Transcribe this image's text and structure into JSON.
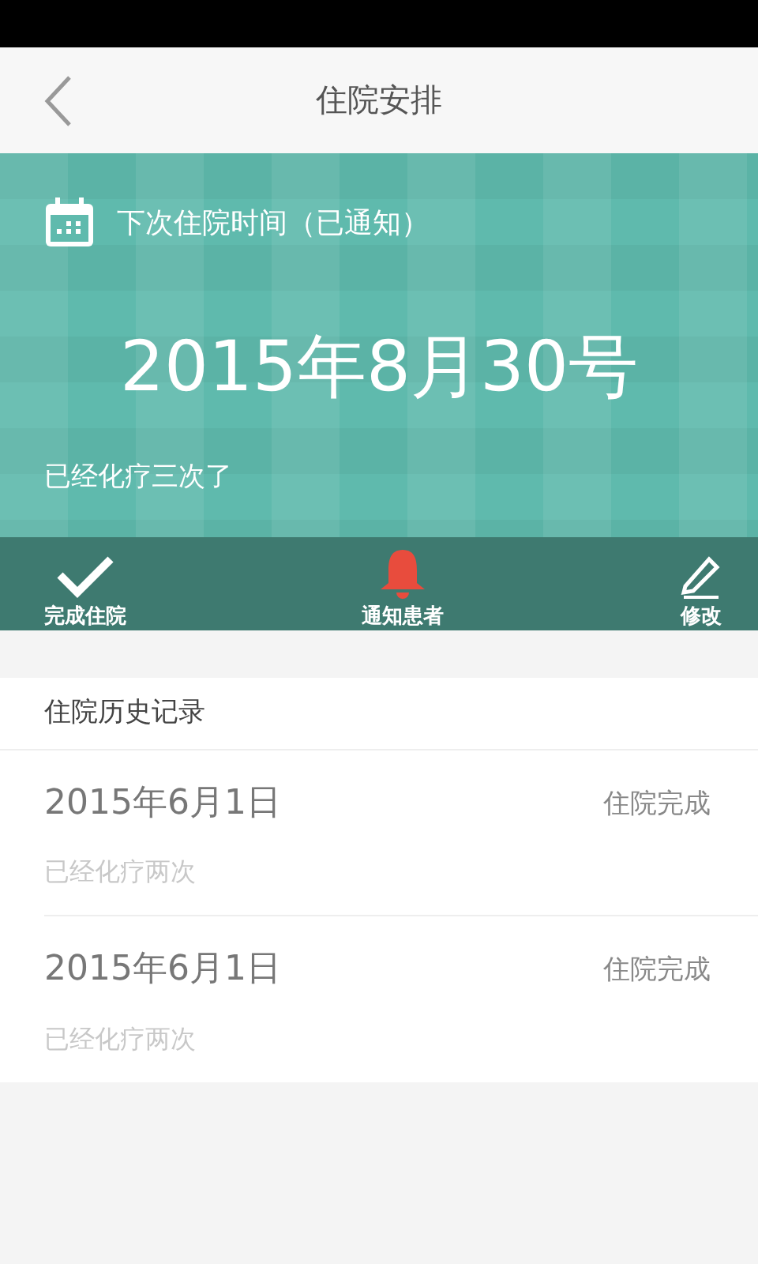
{
  "header": {
    "title": "住院安排"
  },
  "banner": {
    "label": "下次住院时间（已通知）",
    "date": "2015年8月30号",
    "note": "已经化疗三次了"
  },
  "actions": [
    {
      "kind": "check",
      "label": "完成住院"
    },
    {
      "kind": "bell",
      "label": "通知患者"
    },
    {
      "kind": "pencil",
      "label": "修改"
    }
  ],
  "history": {
    "title": "住院历史记录",
    "records": [
      {
        "date": "2015年6月1日",
        "status": "住院完成",
        "note": "已经化疗两次"
      },
      {
        "date": "2015年6月1日",
        "status": "住院完成",
        "note": "已经化疗两次"
      }
    ]
  }
}
